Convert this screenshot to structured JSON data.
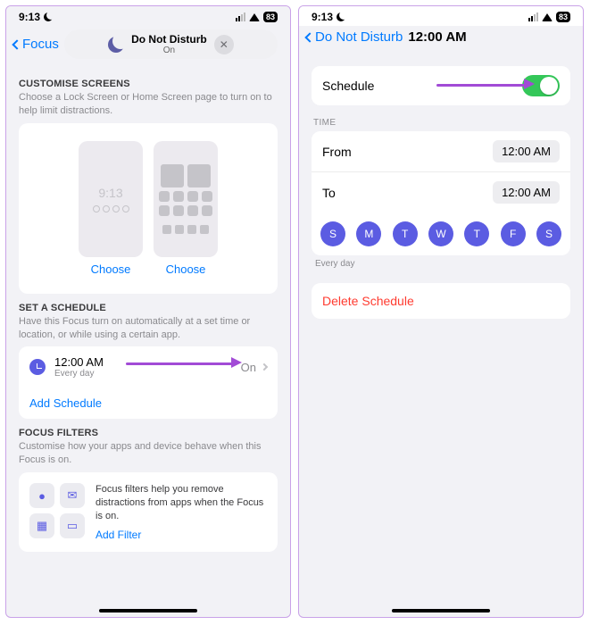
{
  "status": {
    "time": "9:13",
    "battery": "83"
  },
  "left": {
    "nav": {
      "back": "Focus",
      "title": "Do Not Disturb",
      "subtitle": "On"
    },
    "customise": {
      "heading": "CUSTOMISE SCREENS",
      "sub": "Choose a Lock Screen or Home Screen page to turn on to help limit distractions.",
      "lock_time": "9:13",
      "choose": "Choose"
    },
    "schedule": {
      "heading": "SET A SCHEDULE",
      "sub": "Have this Focus turn on automatically at a set time or location, or while using a certain app.",
      "time": "12:00 AM",
      "repeat": "Every day",
      "state": "On",
      "add": "Add Schedule"
    },
    "filters": {
      "heading": "FOCUS FILTERS",
      "sub": "Customise how your apps and device behave when this Focus is on.",
      "desc": "Focus filters help you remove distractions from apps when the Focus is on.",
      "add": "Add Filter"
    }
  },
  "right": {
    "nav": {
      "back": "Do Not Disturb",
      "title": "12:00 AM"
    },
    "schedule_label": "Schedule",
    "time_heading": "TIME",
    "from_label": "From",
    "from_value": "12:00 AM",
    "to_label": "To",
    "to_value": "12:00 AM",
    "days": [
      "S",
      "M",
      "T",
      "W",
      "T",
      "F",
      "S"
    ],
    "repeat_caption": "Every day",
    "delete": "Delete Schedule"
  }
}
